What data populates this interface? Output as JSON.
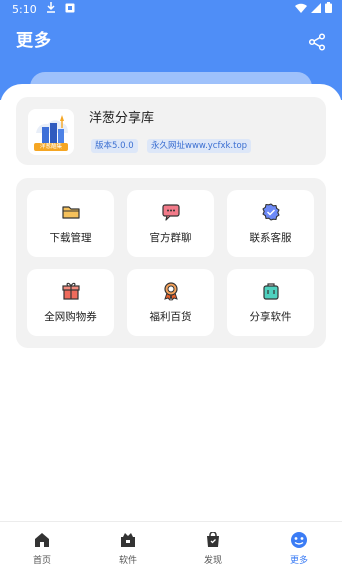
{
  "status_bar": {
    "time": "5:10"
  },
  "header": {
    "title": "更多"
  },
  "app_info": {
    "name": "洋葱分享库",
    "logo_text": "洋葱酷集",
    "version_badge": "版本5.0.0",
    "url_badge": "永久网址www.ycfxk.top"
  },
  "grid": {
    "items": [
      {
        "label": "下载管理",
        "icon": "folder-icon",
        "color": "#f5a623"
      },
      {
        "label": "官方群聊",
        "icon": "chat-icon",
        "color": "#e0465b"
      },
      {
        "label": "联系客服",
        "icon": "service-icon",
        "color": "#4f6df5"
      },
      {
        "label": "全网购物券",
        "icon": "gift-icon",
        "color": "#e64a3b"
      },
      {
        "label": "福利百货",
        "icon": "medal-icon",
        "color": "#e8612c"
      },
      {
        "label": "分享软件",
        "icon": "bag-icon",
        "color": "#1fb5a4"
      }
    ]
  },
  "bottom_nav": {
    "items": [
      {
        "label": "首页",
        "icon": "home-icon"
      },
      {
        "label": "软件",
        "icon": "apps-icon"
      },
      {
        "label": "发现",
        "icon": "discover-icon"
      },
      {
        "label": "更多",
        "icon": "more-icon",
        "active": true
      }
    ]
  },
  "colors": {
    "primary": "#4f8ef7",
    "accent": "#3b7cf5"
  }
}
